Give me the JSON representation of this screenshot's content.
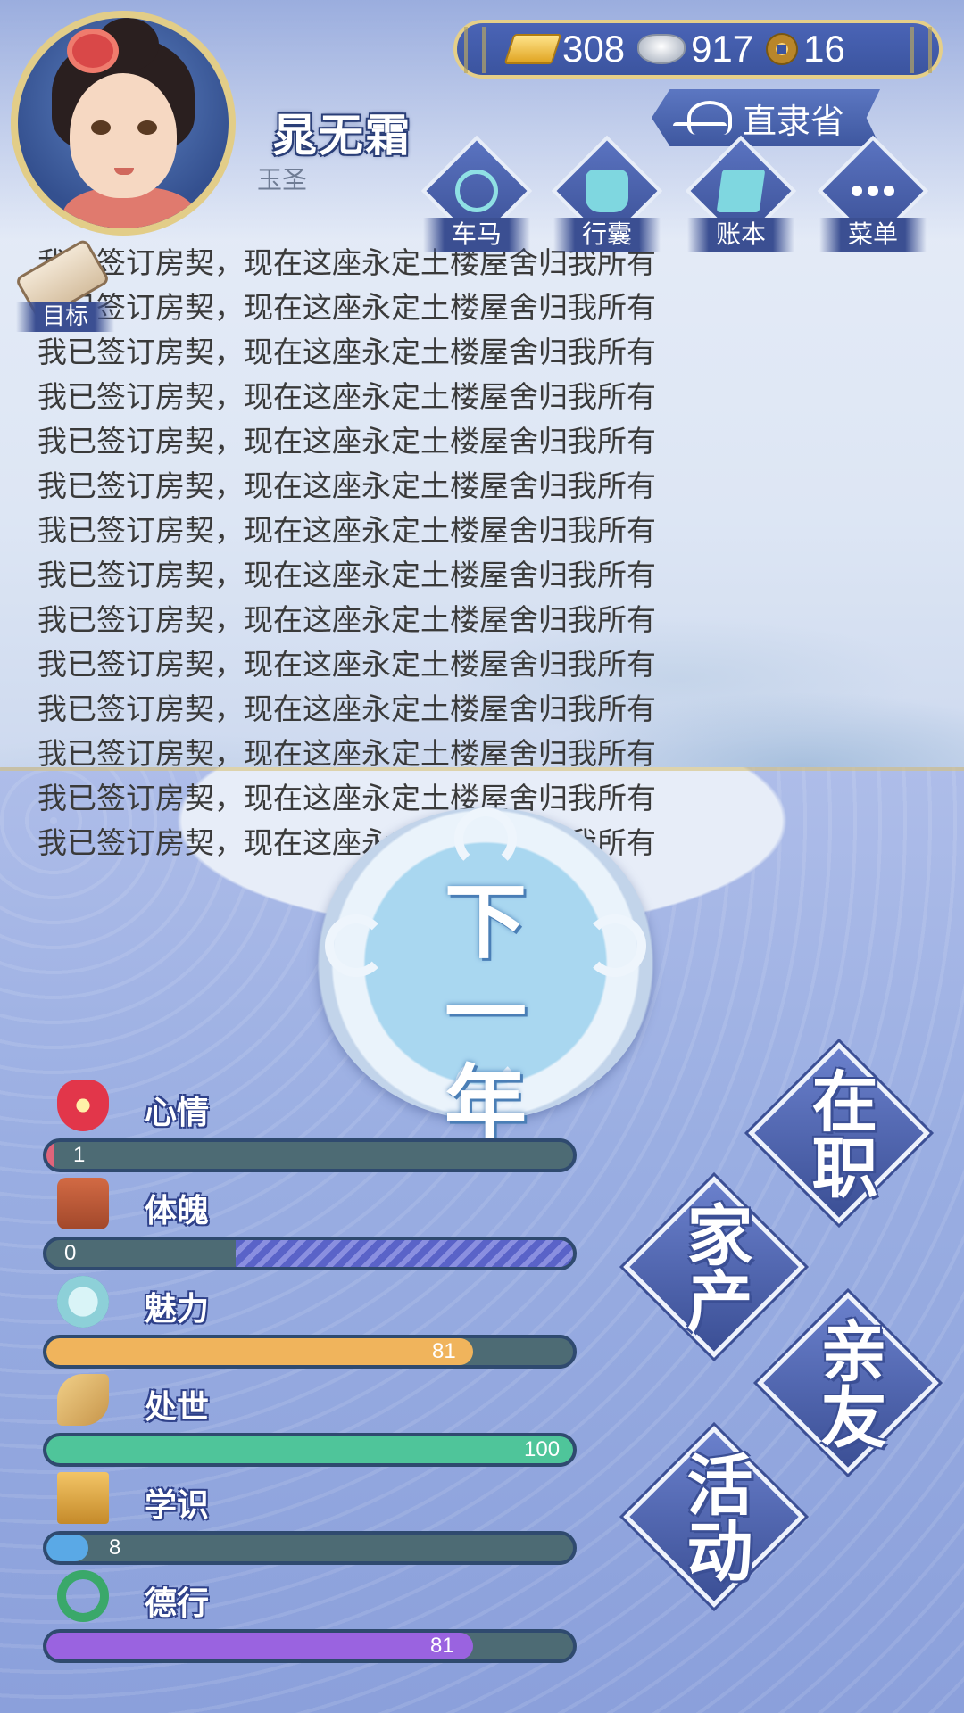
{
  "player": {
    "name": "晁无霜",
    "title": "玉圣"
  },
  "resources": {
    "gold": "308",
    "silver": "917",
    "coins": "16"
  },
  "location": "直隶省",
  "top_menu": [
    {
      "label": "车马",
      "icon": "carriage-icon"
    },
    {
      "label": "行囊",
      "icon": "bag-icon"
    },
    {
      "label": "账本",
      "icon": "ledger-icon"
    },
    {
      "label": "菜单",
      "icon": "menu-dots-icon"
    }
  ],
  "goal": {
    "label": "目标",
    "icon": "scroll-icon"
  },
  "event_log": [
    "我已签订房契，现在这座永定土楼屋舍归我所有",
    "我已签订房契，现在这座永定土楼屋舍归我所有",
    "我已签订房契，现在这座永定土楼屋舍归我所有",
    "我已签订房契，现在这座永定土楼屋舍归我所有",
    "我已签订房契，现在这座永定土楼屋舍归我所有",
    "我已签订房契，现在这座永定土楼屋舍归我所有",
    "我已签订房契，现在这座永定土楼屋舍归我所有",
    "我已签订房契，现在这座永定土楼屋舍归我所有",
    "我已签订房契，现在这座永定土楼屋舍归我所有",
    "我已签订房契，现在这座永定土楼屋舍归我所有",
    "我已签订房契，现在这座永定土楼屋舍归我所有",
    "我已签订房契，现在这座永定土楼屋舍归我所有",
    "我已签订房契，现在这座永定土楼屋舍归我所有",
    "我已签订房契，现在这座永定土楼屋舍归我所有"
  ],
  "next_year": {
    "line1": "下一",
    "line2": "年"
  },
  "stats": [
    {
      "label": "心情",
      "value": "1",
      "fill": 0.01,
      "color": "#e0647a",
      "icon": "flower-icon"
    },
    {
      "label": "体魄",
      "value": "0",
      "fill": 0.36,
      "color": "#4d6b74",
      "icon": "body-icon"
    },
    {
      "label": "魅力",
      "value": "81",
      "fill": 0.81,
      "color": "#f0b45c",
      "icon": "mirror-icon"
    },
    {
      "label": "处世",
      "value": "100",
      "fill": 1.0,
      "color": "#4fc59a",
      "icon": "fan-icon"
    },
    {
      "label": "学识",
      "value": "8",
      "fill": 0.08,
      "color": "#5aa9e6",
      "icon": "books-icon"
    },
    {
      "label": "德行",
      "value": "81",
      "fill": 0.81,
      "color": "#9a63e0",
      "icon": "jade-icon"
    }
  ],
  "actions": [
    {
      "label": "在职",
      "name": "job-button"
    },
    {
      "label": "家产",
      "name": "property-button"
    },
    {
      "label": "亲友",
      "name": "friends-button"
    },
    {
      "label": "活动",
      "name": "activities-button"
    }
  ],
  "colors": {
    "accent_gold": "#e2cd88",
    "panel_blue": "#3b549f",
    "stat_bar_bg": "#4d6b74"
  }
}
